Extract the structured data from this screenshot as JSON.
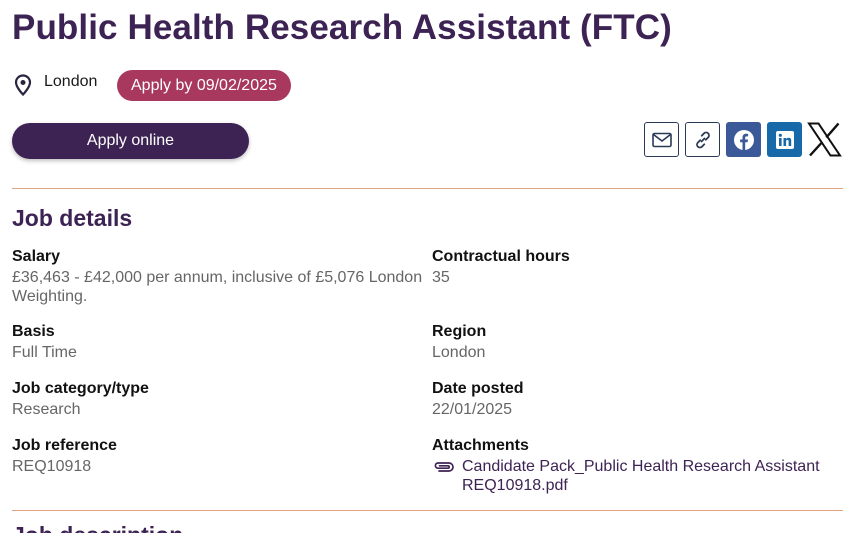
{
  "job": {
    "title": "Public Health Research Assistant (FTC)",
    "location": "London",
    "deadline": "Apply by 09/02/2025",
    "apply_label": "Apply online"
  },
  "share": {
    "buttons": [
      {
        "name": "email",
        "icon": "envelope-icon"
      },
      {
        "name": "copy-link",
        "icon": "link-icon"
      },
      {
        "name": "facebook",
        "icon": "facebook-icon",
        "color": "#3b5998"
      },
      {
        "name": "linkedin",
        "icon": "linkedin-icon",
        "color": "#1769a8"
      },
      {
        "name": "x",
        "icon": "x-icon"
      }
    ]
  },
  "details": {
    "heading": "Job details",
    "salary": {
      "label": "Salary",
      "value": "£36,463 - £42,000 per annum, inclusive of £5,076 London Weighting."
    },
    "hours": {
      "label": "Contractual hours",
      "value": "35"
    },
    "basis": {
      "label": "Basis",
      "value": "Full Time"
    },
    "region": {
      "label": "Region",
      "value": "London"
    },
    "category": {
      "label": "Job category/type",
      "value": "Research"
    },
    "posted": {
      "label": "Date posted",
      "value": "22/01/2025"
    },
    "reference": {
      "label": "Job reference",
      "value": "REQ10918"
    },
    "attachments": {
      "label": "Attachments",
      "file": "Candidate Pack_Public Health Research Assistant REQ10918.pdf"
    }
  },
  "next_section": {
    "heading": "Job description"
  },
  "colors": {
    "primary": "#3d2353",
    "deadline_badge": "#a8385e",
    "divider": "#e0a27f"
  }
}
